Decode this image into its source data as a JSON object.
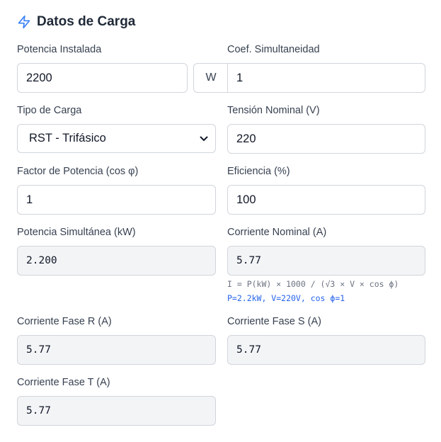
{
  "header": {
    "icon": "lightning-icon",
    "title": "Datos de Carga"
  },
  "fields": {
    "potencia_instalada": {
      "label": "Potencia Instalada",
      "value": "2200",
      "unit": "W"
    },
    "coef_simultaneidad": {
      "label": "Coef. Simultaneidad",
      "value": "1"
    },
    "tipo_carga": {
      "label": "Tipo de Carga",
      "value": "RST - Trifásico"
    },
    "tension_nominal": {
      "label": "Tensión Nominal (V)",
      "value": "220"
    },
    "factor_potencia": {
      "label": "Factor de Potencia (cos φ)",
      "value": "1"
    },
    "eficiencia": {
      "label": "Eficiencia (%)",
      "value": "100"
    },
    "potencia_simultanea": {
      "label": "Potencia Simultánea (kW)",
      "value": "2.200"
    },
    "corriente_nominal": {
      "label": "Corriente Nominal (A)",
      "value": "5.77",
      "formula": "I = P(kW) × 1000 / (√3 × V × cos ϕ)",
      "formula_values": "P=2.2kW, V=220V, cos ϕ=1"
    },
    "corriente_fase_r": {
      "label": "Corriente Fase R (A)",
      "value": "5.77"
    },
    "corriente_fase_s": {
      "label": "Corriente Fase S (A)",
      "value": "5.77"
    },
    "corriente_fase_t": {
      "label": "Corriente Fase T (A)",
      "value": "5.77"
    }
  },
  "colors": {
    "accent": "#3b82f6",
    "readonly_bg": "#f3f4f6",
    "formula_blue": "#2563eb"
  }
}
